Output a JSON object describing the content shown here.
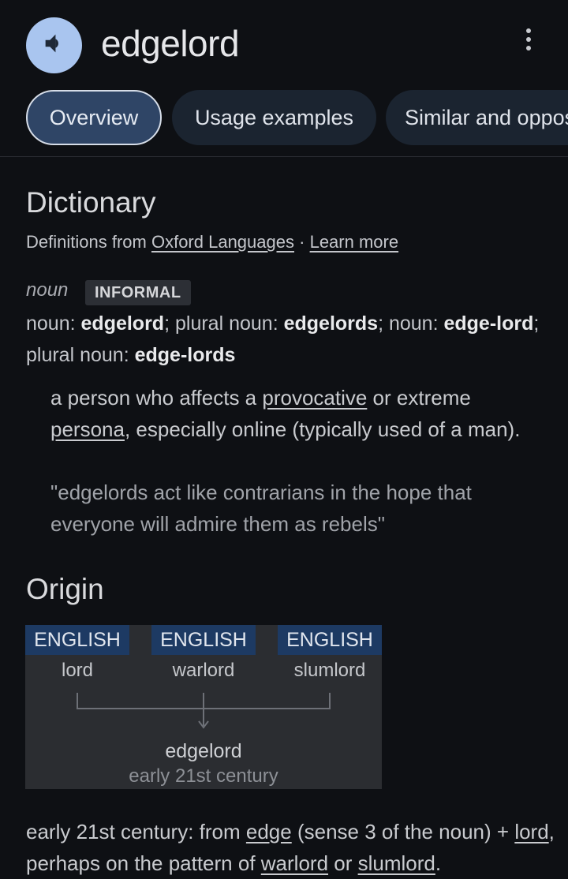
{
  "header": {
    "word": "edgelord",
    "speaker_icon": "volume-icon",
    "menu_icon": "more-vert-icon"
  },
  "tabs": [
    {
      "label": "Overview",
      "active": true
    },
    {
      "label": "Usage examples",
      "active": false
    },
    {
      "label": "Similar and opposite words",
      "active": false
    }
  ],
  "dictionary": {
    "heading": "Dictionary",
    "source_prefix": "Definitions from",
    "source_link": "Oxford Languages",
    "separator": "·",
    "learn_more": "Learn more"
  },
  "entry": {
    "part_of_speech": "noun",
    "register": "INFORMAL",
    "forms": [
      {
        "label": "noun: ",
        "value": "edgelord"
      },
      {
        "label": "; plural noun: ",
        "value": "edgelords"
      },
      {
        "label": "; noun: ",
        "value": "edge-lord"
      },
      {
        "label": "; plural noun: ",
        "value": "edge-lords"
      }
    ],
    "definition": {
      "part1": "a person who affects a ",
      "link1": "provocative",
      "part2": " or extreme ",
      "link2": "persona",
      "part3": ", especially online (typically used of a man)."
    },
    "example": "\"edgelords act like contrarians in the hope that everyone will admire them as rebels\""
  },
  "origin": {
    "heading": "Origin",
    "roots": [
      {
        "language": "ENGLISH",
        "word": "lord"
      },
      {
        "language": "ENGLISH",
        "word": "warlord"
      },
      {
        "language": "ENGLISH",
        "word": "slumlord"
      }
    ],
    "result_word": "edgelord",
    "result_era": "early 21st century",
    "etymology": {
      "t1": "early 21st century: from ",
      "l1": "edge",
      "t2": " (sense 3 of the noun) + ",
      "l2": "lord",
      "t3": ", perhaps on the pattern of ",
      "l3": "warlord",
      "t4": " or ",
      "l4": "slumlord",
      "t5": "."
    }
  },
  "colors": {
    "background": "#0e1014",
    "speaker_circle": "#a9c5ef",
    "active_tab": "#2f4566",
    "language_tag": "#1d3a63"
  }
}
